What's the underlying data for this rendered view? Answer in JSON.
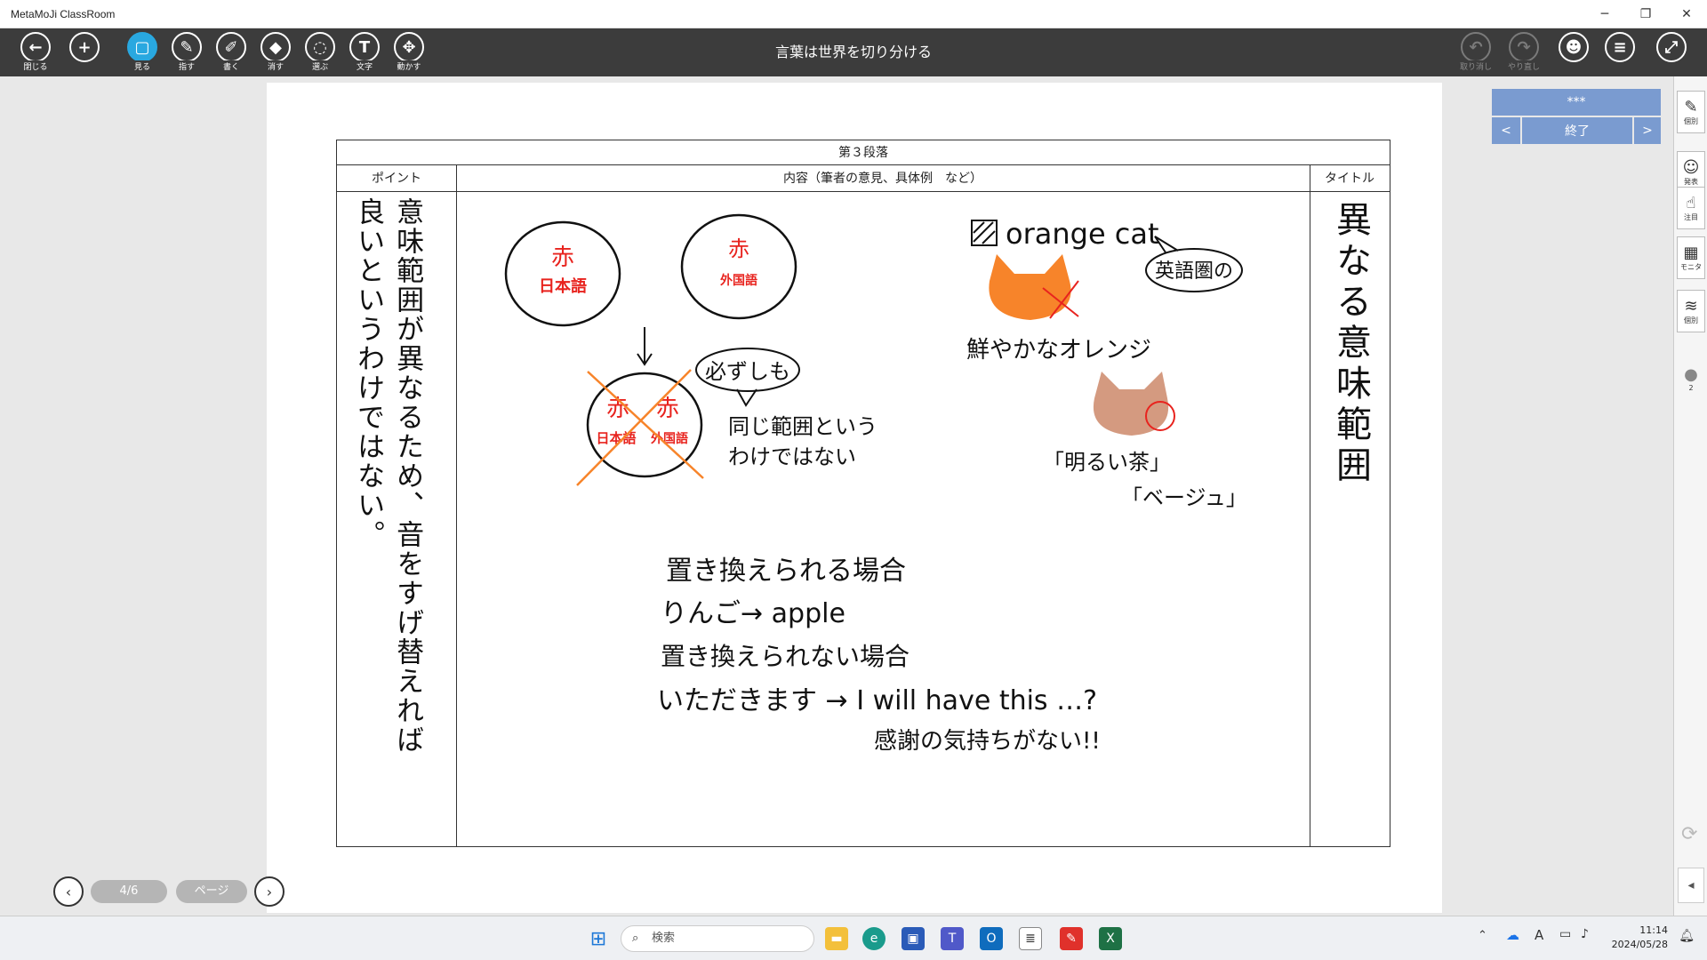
{
  "window": {
    "app_name": "MetaMoJi ClassRoom",
    "minimize": "─",
    "restore": "❐",
    "close": "✕"
  },
  "toolbar": {
    "doc_title": "言葉は世界を切り分ける",
    "tools": [
      {
        "label": "閉じる",
        "glyph": "←"
      },
      {
        "label": "",
        "glyph": "+"
      },
      {
        "label": "見る",
        "glyph": "▢"
      },
      {
        "label": "指す",
        "glyph": "✎"
      },
      {
        "label": "書く",
        "glyph": "✐"
      },
      {
        "label": "消す",
        "glyph": "◆"
      },
      {
        "label": "選ぶ",
        "glyph": "◌"
      },
      {
        "label": "文字",
        "glyph": "T"
      },
      {
        "label": "動かす",
        "glyph": "✥"
      }
    ],
    "undo_label": "取り消し",
    "redo_label": "やり直し"
  },
  "table": {
    "header": "第３段落",
    "col_point": "ポイント",
    "col_content": "内容（筆者の意見、具体例　など）",
    "col_title": "タイトル"
  },
  "handwriting": {
    "point_col1": "意味範囲が異なるため、音をすげ替えれば",
    "point_col2": "良いというわけではない。",
    "title_col": "異なる意味範囲",
    "circle1_top": "赤",
    "circle1_bottom": "日本語",
    "circle2_top": "赤",
    "circle2_bottom": "外国語",
    "merged_left_top": "赤",
    "merged_left_bottom": "日本語",
    "merged_right_top": "赤",
    "merged_right_bottom": "外国語",
    "bubble_kanarazu": "必ずしも",
    "same_range_1": "同じ範囲という",
    "same_range_2": "わけではない",
    "orange_cat": "orange cat",
    "eigoken": "英語圏の",
    "azayaka": "鮮やかなオレンジ",
    "akarui_cha": "「明るい茶」",
    "beige": "「ベージュ」",
    "replaceable": "置き換えられる場合",
    "ringo": "りんご→ apple",
    "not_replaceable": "置き換えられない場合",
    "itadakimasu": "いただきます → I will have this …?",
    "kansha": "感謝の気持ちがない!!"
  },
  "right_panel": {
    "top": "***",
    "prev": "<",
    "end": "終了",
    "next": ">"
  },
  "sidebar": [
    {
      "label": "個別",
      "glyph": "✎"
    },
    {
      "label": "発表",
      "glyph": "☺"
    },
    {
      "label": "注目",
      "glyph": "☝"
    },
    {
      "label": "モニタ",
      "glyph": "▦"
    },
    {
      "label": "個別",
      "glyph": "≋"
    },
    {
      "label": "2",
      "glyph": "●"
    }
  ],
  "pager": {
    "page": "4/6",
    "page_label": "ページ"
  },
  "taskbar": {
    "search_placeholder": "検索",
    "time": "11:14",
    "date": "2024/05/28"
  },
  "colors": {
    "toolbar_bg": "#3c3c3c",
    "active_tool": "#29a8e0",
    "red_ink": "#e8231e",
    "orange": "#f7842a",
    "cat_brown": "#d49a80",
    "panel_blue": "#7a9bd0"
  }
}
